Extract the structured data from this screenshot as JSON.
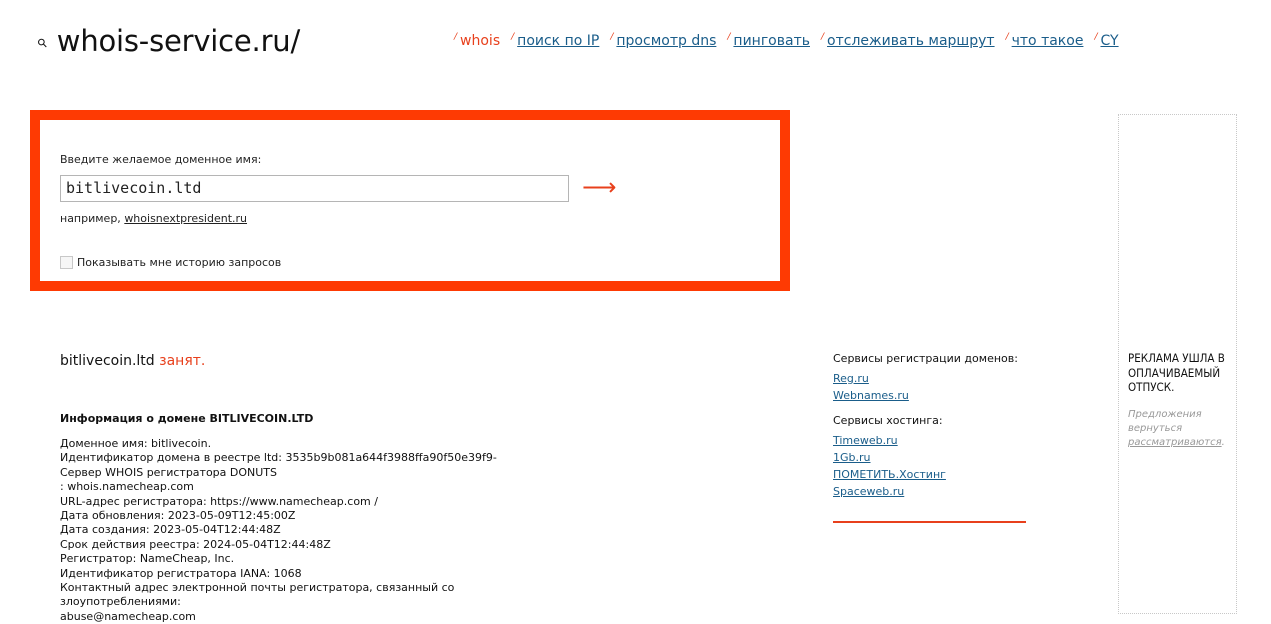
{
  "header": {
    "logo_text": "whois-service.ru/",
    "nav": [
      {
        "label": "whois",
        "active": true
      },
      {
        "label": "поиск по IP",
        "active": false
      },
      {
        "label": "просмотр dns",
        "active": false
      },
      {
        "label": "пинговать",
        "active": false
      },
      {
        "label": "отслеживать маршрут",
        "active": false
      },
      {
        "label": "что такое",
        "active": false
      },
      {
        "label": "CY",
        "active": false
      }
    ]
  },
  "search": {
    "prompt": "Введите желаемое доменное имя:",
    "value": "bitlivecoin.ltd",
    "example_prefix": "например, ",
    "example_link": "whoisnextpresident.ru",
    "history_label": "Показывать мне историю запросов"
  },
  "result": {
    "domain": "bitlivecoin.ltd",
    "status": "занят.",
    "info_heading": "Информация о домене BITLIVECOIN.LTD",
    "lines": [
      "Доменное имя: bitlivecoin.",
      "Идентификатор домена в реестре ltd: 3535b9b081a644f3988ffa90f50e39f9-Сервер WHOIS регистратора DONUTS",
      ": whois.namecheap.com",
      "URL-адрес регистратора: https://www.namecheap.com /",
      "Дата обновления: 2023-05-09T12:45:00Z",
      "Дата создания: 2023-05-04T12:44:48Z",
      "Срок действия реестра: 2024-05-04T12:44:48Z",
      "Регистратор: NameCheap, Inc.",
      "Идентификатор регистратора IANA: 1068",
      "Контактный адрес электронной почты регистратора, связанный со злоупотреблениями:",
      "abuse@namecheap.com"
    ]
  },
  "services": {
    "registration_heading": "Сервисы регистрации доменов:",
    "registration_links": [
      "Reg.ru",
      "Webnames.ru"
    ],
    "hosting_heading": "Сервисы хостинга:",
    "hosting_links": [
      "Timeweb.ru",
      "1Gb.ru",
      "ПОМЕТИТЬ.Хостинг",
      "Spaceweb.ru"
    ]
  },
  "ad": {
    "title": "РЕКЛАМА УШЛА В ОПЛАЧИВАЕМЫЙ ОТПУСК.",
    "note_prefix": "Предложения вернуться ",
    "note_link": "рассматриваются",
    "note_suffix": "."
  },
  "colors": {
    "accent": "#fe3a03",
    "link": "#1a5d8a"
  }
}
